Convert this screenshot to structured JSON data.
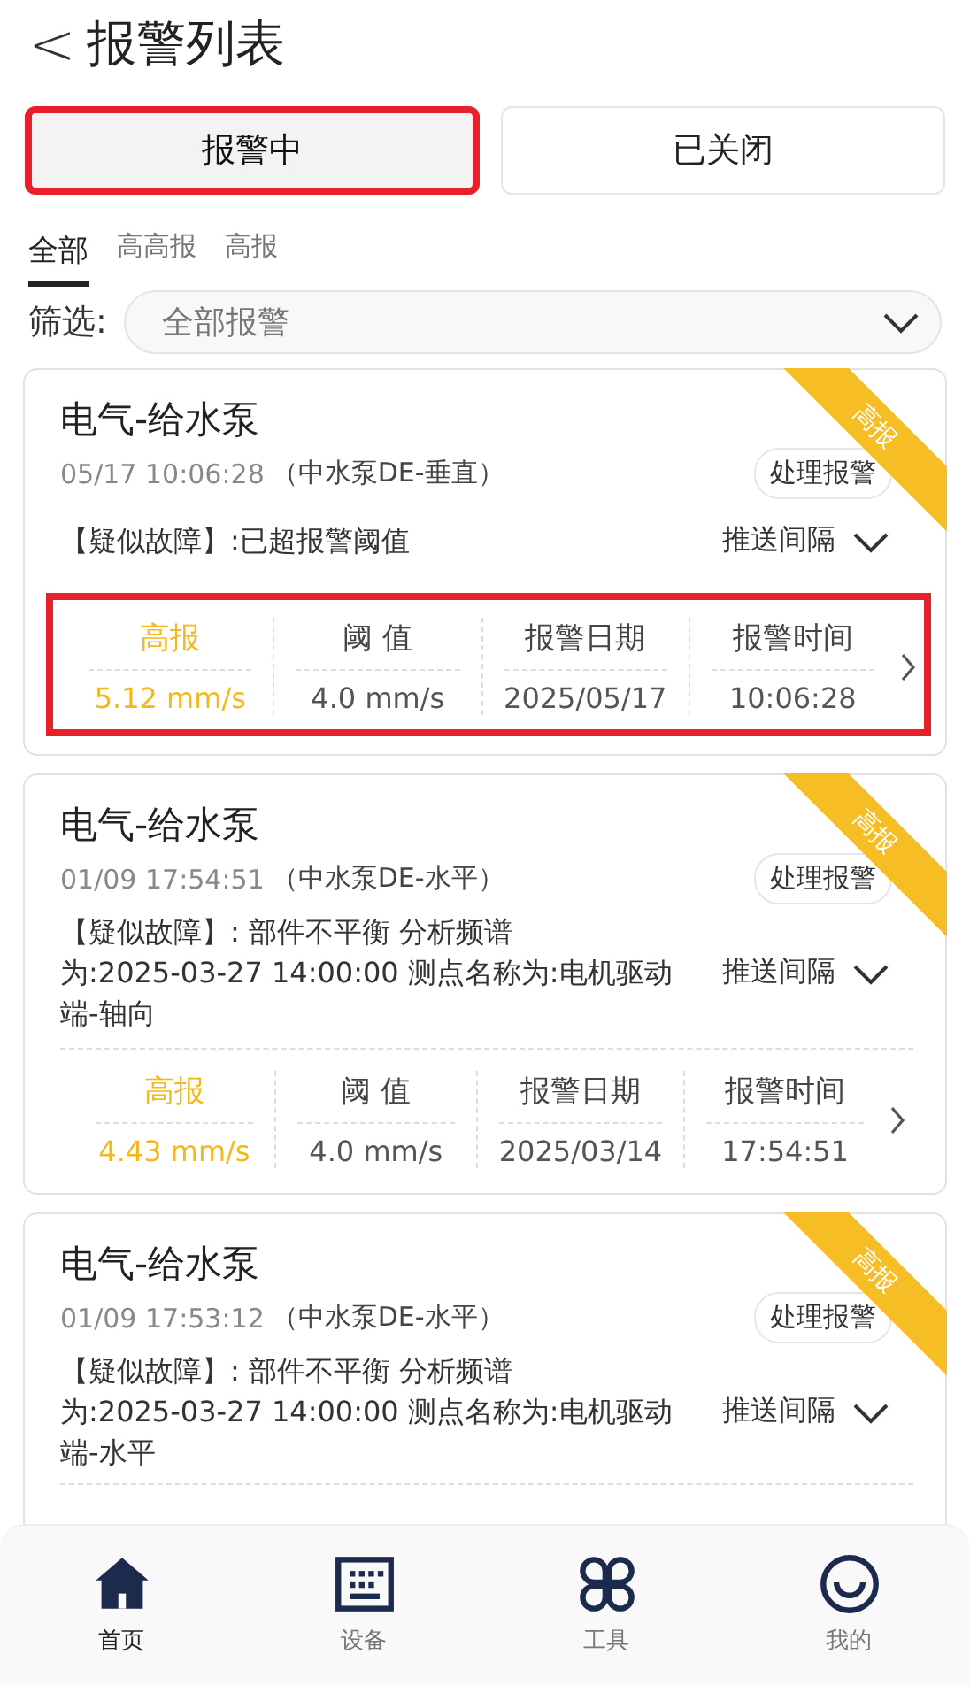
{
  "header": {
    "back": "<",
    "title": "报警列表"
  },
  "tabs": [
    {
      "label": "报警中",
      "selected": true,
      "highlighted": true
    },
    {
      "label": "已关闭",
      "selected": false,
      "highlighted": false
    }
  ],
  "level_tabs": [
    {
      "label": "全部",
      "selected": true
    },
    {
      "label": "高高报",
      "selected": false
    },
    {
      "label": "高报",
      "selected": false
    }
  ],
  "filter": {
    "label": "筛选:",
    "value": "全部报警"
  },
  "cards": [
    {
      "title": "电气-给水泵",
      "time": "05/17 10:06:28",
      "point": "（中水泵DE-垂直）",
      "ribbon": "高报",
      "action": "处理报警",
      "fault": "【疑似故障】:已超报警阈值",
      "push": "推送间隔",
      "highlighted": true,
      "metrics": [
        {
          "label": "高报",
          "value": "5.12 mm/s",
          "emphasized": true
        },
        {
          "label": "阈 值",
          "value": "4.0 mm/s",
          "emphasized": false
        },
        {
          "label": "报警日期",
          "value": "2025/05/17",
          "emphasized": false
        },
        {
          "label": "报警时间",
          "value": "10:06:28",
          "emphasized": false
        }
      ]
    },
    {
      "title": "电气-给水泵",
      "time": "01/09 17:54:51",
      "point": "（中水泵DE-水平）",
      "ribbon": "高报",
      "action": "处理报警",
      "fault": "【疑似故障】: 部件不平衡 分析频谱为:2025-03-27 14:00:00 测点名称为:电机驱动端-轴向",
      "push": "推送间隔",
      "highlighted": false,
      "metrics": [
        {
          "label": "高报",
          "value": "4.43 mm/s",
          "emphasized": true
        },
        {
          "label": "阈 值",
          "value": "4.0 mm/s",
          "emphasized": false
        },
        {
          "label": "报警日期",
          "value": "2025/03/14",
          "emphasized": false
        },
        {
          "label": "报警时间",
          "value": "17:54:51",
          "emphasized": false
        }
      ]
    },
    {
      "title": "电气-给水泵",
      "time": "01/09 17:53:12",
      "point": "（中水泵DE-水平）",
      "ribbon": "高报",
      "action": "处理报警",
      "fault": "【疑似故障】: 部件不平衡 分析频谱为:2025-03-27 14:00:00 测点名称为:电机驱动端-水平",
      "push": "推送间隔"
    }
  ],
  "nav": [
    {
      "label": "首页",
      "selected": true
    },
    {
      "label": "设备",
      "selected": false
    },
    {
      "label": "工具",
      "selected": false
    },
    {
      "label": "我的",
      "selected": false
    }
  ]
}
